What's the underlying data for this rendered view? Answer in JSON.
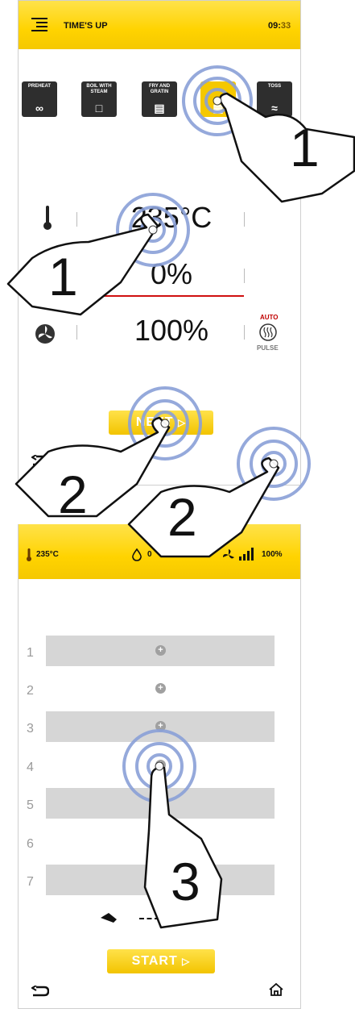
{
  "screen1": {
    "header": {
      "title": "TIME'S UP",
      "time_hours": "09:",
      "time_minutes": "33"
    },
    "modes": [
      {
        "label": "PREHEAT"
      },
      {
        "label": "BOIL WITH STEAM"
      },
      {
        "label": "FRY AND GRATIN"
      },
      {
        "label": ""
      },
      {
        "label": "TOSS"
      }
    ],
    "temperature": "235°C",
    "humidity": "0%",
    "fan": "100%",
    "auto_label": "AUTO",
    "pulse_label": "PULSE",
    "next_button": "NEXT"
  },
  "screen2": {
    "status": {
      "temperature": "235°C",
      "humidity": "0",
      "fan": "100%"
    },
    "shelves": [
      "1",
      "2",
      "3",
      "4",
      "5",
      "6",
      "7"
    ],
    "start_button": "START"
  },
  "annotations": {
    "step1a": "1",
    "step1b": "1",
    "step2a": "2",
    "step2b": "2",
    "step3": "3"
  },
  "colors": {
    "accent": "#ffd300",
    "touch_ring": "#8aa0d8",
    "humidity_line": "#d01010"
  }
}
